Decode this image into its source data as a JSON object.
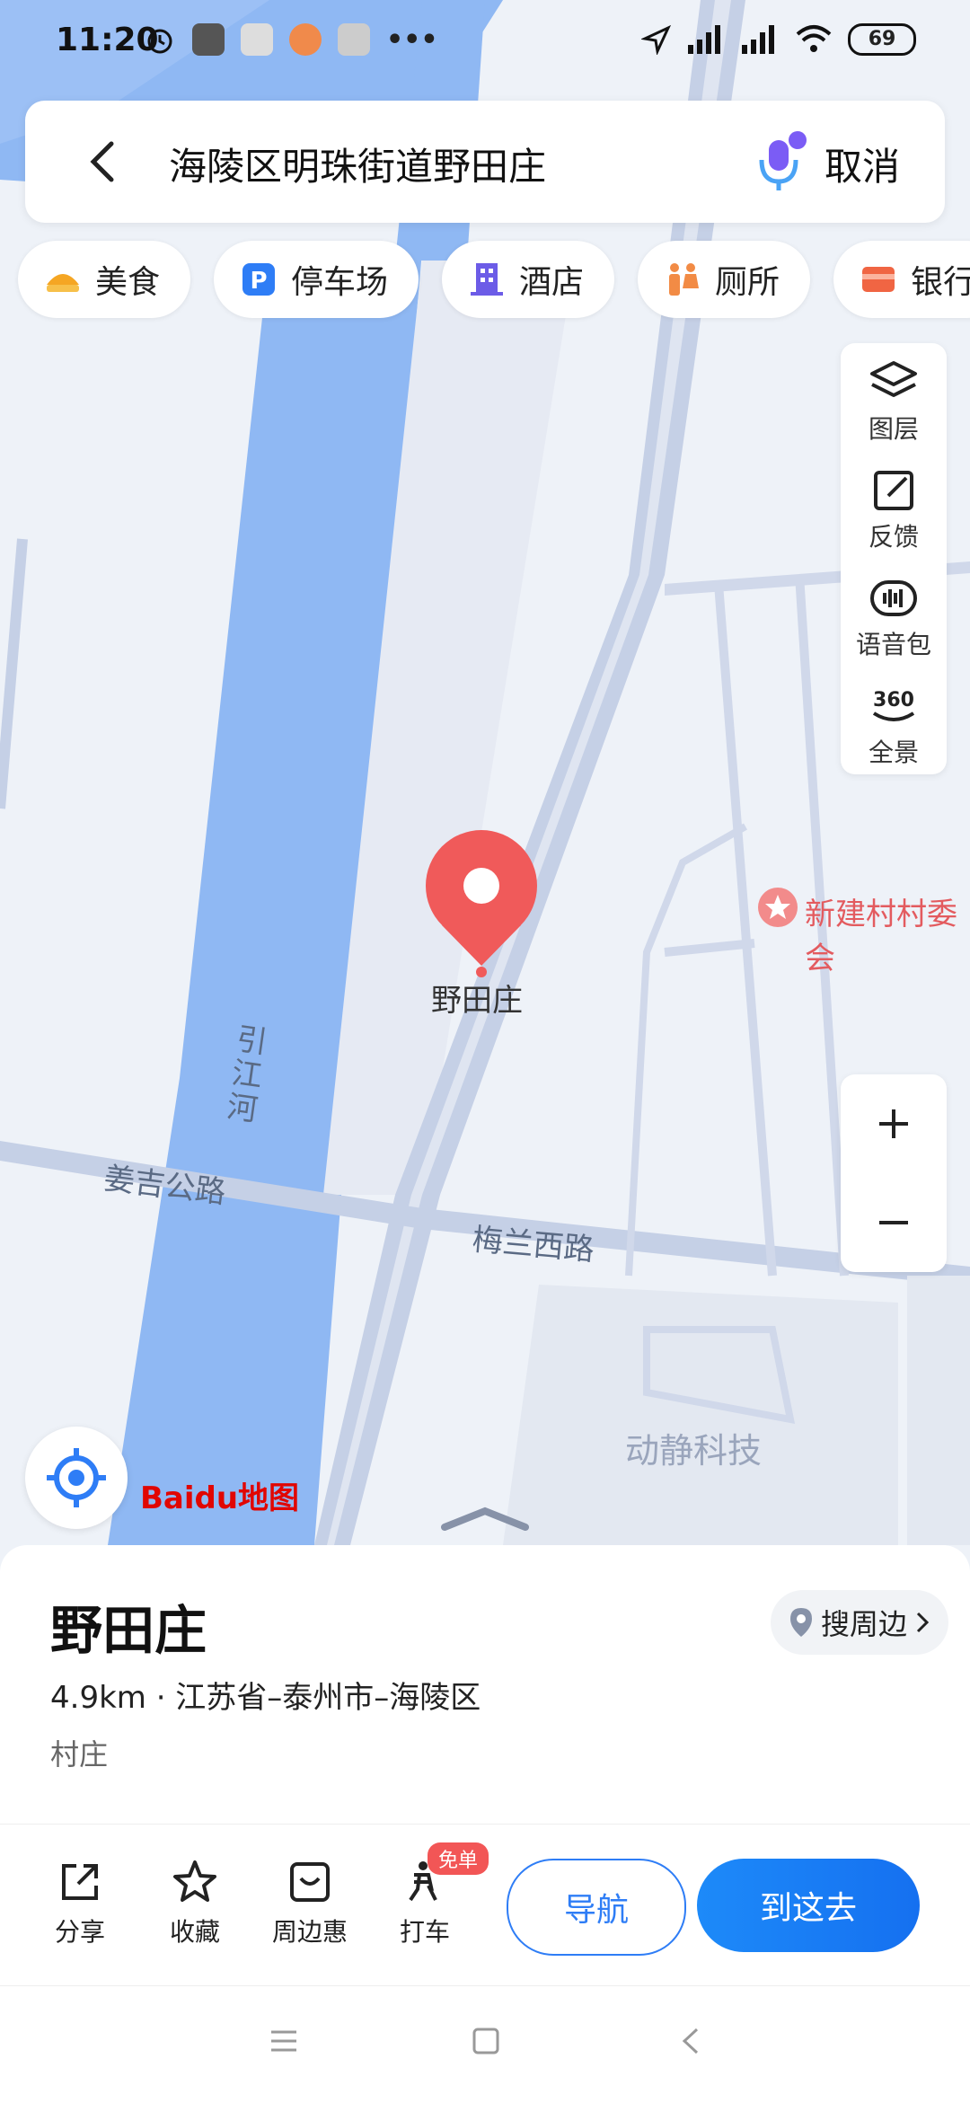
{
  "status": {
    "time": "11:20",
    "battery": "69"
  },
  "search": {
    "query": "海陵区明珠街道野田庄",
    "cancel": "取消"
  },
  "chips": [
    {
      "label": "美食",
      "icon": "food-icon",
      "color": "#f5a623"
    },
    {
      "label": "停车场",
      "icon": "parking-icon",
      "color": "#2e7df6"
    },
    {
      "label": "酒店",
      "icon": "hotel-icon",
      "color": "#6c5ce7"
    },
    {
      "label": "厕所",
      "icon": "toilet-icon",
      "color": "#f28b45"
    },
    {
      "label": "银行",
      "icon": "bank-icon",
      "color": "#f06543"
    }
  ],
  "tools": {
    "layers": "图层",
    "feedback": "反馈",
    "voice_pack": "语音包",
    "panorama": "全景",
    "panorama_icon_text": "360"
  },
  "map": {
    "marker_label": "野田庄",
    "poi_label": "新建村村委会",
    "river_label": "引江河",
    "road_jiangji": "姜吉公路",
    "road_meilan": "梅兰西路",
    "company_label": "动静科技",
    "logo": "Baidu地图",
    "water_color": "#8fb8f3",
    "land_color": "#eef2f8"
  },
  "place": {
    "title": "野田庄",
    "address": "4.9km · 江苏省–泰州市–海陵区",
    "type": "村庄",
    "nearby": "搜周边"
  },
  "actions": {
    "share": "分享",
    "favorite": "收藏",
    "nearby_deals": "周边惠",
    "taxi": "打车",
    "taxi_badge": "免单",
    "navigate": "导航",
    "go_here": "到这去"
  },
  "accent": "#2e7df6"
}
